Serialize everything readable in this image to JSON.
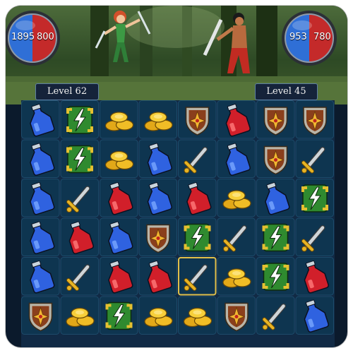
{
  "player": {
    "health": "1895",
    "mana": "800",
    "level_label": "Level 62"
  },
  "enemy": {
    "health": "953",
    "mana": "780",
    "level_label": "Level 45"
  },
  "colors": {
    "health_blue": "#2f6fd6",
    "health_red": "#c42a2a",
    "board_bg": "#112a45",
    "cell_bg": "#0e3550",
    "selection": "#e0c04a"
  },
  "board": {
    "rows": [
      [
        "potion-blue",
        "lightning",
        "coins",
        "coins",
        "shield",
        "potion-red",
        "shield",
        "shield"
      ],
      [
        "potion-blue",
        "lightning",
        "coins",
        "potion-blue",
        "sword",
        "potion-blue",
        "shield",
        "sword"
      ],
      [
        "potion-blue",
        "sword",
        "potion-red",
        "potion-blue",
        "potion-red",
        "coins",
        "potion-blue",
        "lightning"
      ],
      [
        "potion-blue",
        "potion-red",
        "potion-blue",
        "shield",
        "lightning",
        "sword",
        "lightning",
        "sword"
      ],
      [
        "potion-blue",
        "sword",
        "potion-red",
        "potion-red",
        "sword",
        "coins",
        "lightning",
        "potion-red"
      ],
      [
        "shield",
        "coins",
        "lightning",
        "coins",
        "coins",
        "shield",
        "sword",
        "potion-blue"
      ]
    ],
    "selected": {
      "row": 4,
      "col": 4
    }
  }
}
